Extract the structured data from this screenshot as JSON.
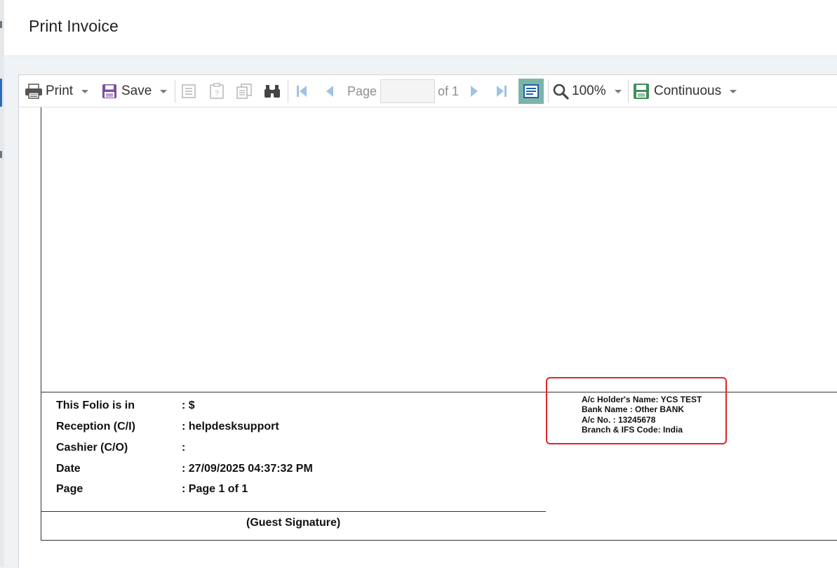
{
  "modal": {
    "title": "Print Invoice"
  },
  "toolbar": {
    "print_label": "Print",
    "save_label": "Save",
    "page_label": "Page",
    "page_value": "",
    "of_label": "of 1",
    "zoom_label": "100%",
    "view_mode_label": "Continuous"
  },
  "invoice": {
    "rows": [
      {
        "label": "This Folio is in",
        "value": ": $"
      },
      {
        "label": "Reception (C/I)",
        "value": ": helpdesksupport"
      },
      {
        "label": "Cashier (C/O)",
        "value": ":"
      },
      {
        "label": "Date",
        "value": ": 27/09/2025 04:37:32 PM"
      },
      {
        "label": "Page",
        "value": ": Page 1 of 1"
      }
    ],
    "signature": "(Guest Signature)",
    "bank": {
      "holder": "A/c Holder's Name: YCS TEST",
      "bank_name": "Bank Name : Other BANK",
      "account_no": "A/c No. : 13245678",
      "branch": "Branch & IFS Code: India"
    }
  },
  "colors": {
    "highlight": "#e0262b",
    "active_button": "#7cb5a8",
    "save_icon": "#7b4fa0",
    "continuous_icon": "#3f8f5a"
  }
}
